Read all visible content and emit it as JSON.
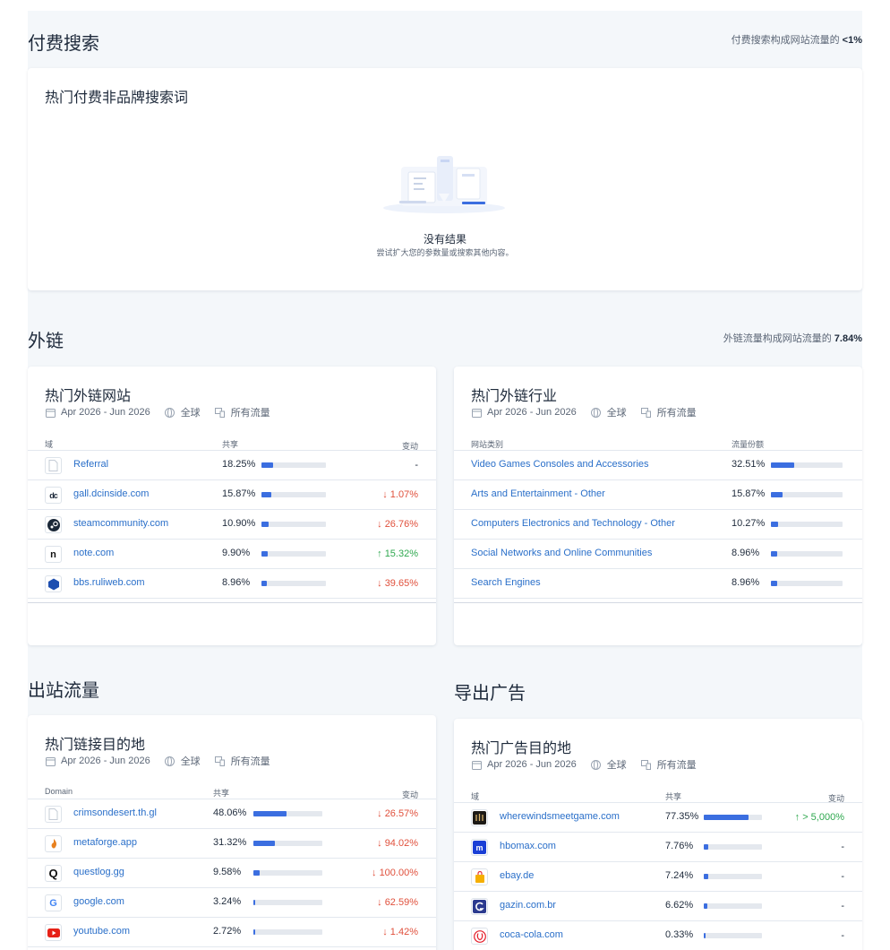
{
  "paid": {
    "title": "付费搜索",
    "note_prefix": "付费搜索构成网站流量的 ",
    "note_value": "<1%",
    "card_title": "热门付费非品牌搜索词",
    "empty_title": "没有结果",
    "empty_sub": "尝试扩大您的参数量或搜索其他内容。"
  },
  "backlinks": {
    "title": "外链",
    "note_prefix": "外链流量构成网站流量的 ",
    "note_value": "7.84%"
  },
  "meta": {
    "date": "Apr 2026 - Jun 2026",
    "region": "全球",
    "traffic": "所有流量"
  },
  "top_sites": {
    "title": "热门外链网站",
    "col_domain": "域",
    "col_share": "共享",
    "col_change": "变动",
    "rows": [
      {
        "name": "Referral",
        "share": "18.25%",
        "share_value": 18.25,
        "change": "-",
        "dir": "flat",
        "icon": "page-icon"
      },
      {
        "name": "gall.dcinside.com",
        "share": "15.87%",
        "share_value": 15.87,
        "change": "1.07%",
        "dir": "down",
        "icon": "dcinside-icon"
      },
      {
        "name": "steamcommunity.com",
        "share": "10.90%",
        "share_value": 10.9,
        "change": "26.76%",
        "dir": "down",
        "icon": "steam-icon"
      },
      {
        "name": "note.com",
        "share": "9.90%",
        "share_value": 9.9,
        "change": "15.32%",
        "dir": "up",
        "icon": "note-icon"
      },
      {
        "name": "bbs.ruliweb.com",
        "share": "8.96%",
        "share_value": 8.96,
        "change": "39.65%",
        "dir": "down",
        "icon": "ruliweb-icon"
      }
    ]
  },
  "top_industries": {
    "title": "热门外链行业",
    "col_category": "网站类别",
    "col_share": "流量份额",
    "rows": [
      {
        "name": "Video Games Consoles and Accessories",
        "share": "32.51%",
        "share_value": 32.51
      },
      {
        "name": "Arts and Entertainment - Other",
        "share": "15.87%",
        "share_value": 15.87
      },
      {
        "name": "Computers Electronics and Technology - Other",
        "share": "10.27%",
        "share_value": 10.27
      },
      {
        "name": "Social Networks and Online Communities",
        "share": "8.96%",
        "share_value": 8.96
      },
      {
        "name": "Search Engines",
        "share": "8.96%",
        "share_value": 8.96
      }
    ]
  },
  "outgoing": {
    "title": "出站流量",
    "card_title": "热门链接目的地",
    "col_domain": "Domain",
    "col_share": "共享",
    "col_change": "变动",
    "rows": [
      {
        "name": "crimsondesert.th.gl",
        "share": "48.06%",
        "share_value": 48.06,
        "change": "26.57%",
        "dir": "down",
        "icon": "page-icon"
      },
      {
        "name": "metaforge.app",
        "share": "31.32%",
        "share_value": 31.32,
        "change": "94.02%",
        "dir": "down",
        "icon": "metaforge-icon"
      },
      {
        "name": "questlog.gg",
        "share": "9.58%",
        "share_value": 9.58,
        "change": "100.00%",
        "dir": "down",
        "icon": "questlog-icon"
      },
      {
        "name": "google.com",
        "share": "3.24%",
        "share_value": 3.24,
        "change": "62.59%",
        "dir": "down",
        "icon": "google-icon"
      },
      {
        "name": "youtube.com",
        "share": "2.72%",
        "share_value": 2.72,
        "change": "1.42%",
        "dir": "down",
        "icon": "youtube-icon"
      }
    ]
  },
  "ads": {
    "title": "导出广告",
    "card_title": "热门广告目的地",
    "col_domain": "域",
    "col_share": "共享",
    "col_change": "变动",
    "rows": [
      {
        "name": "wherewindsmeetgame.com",
        "share": "77.35%",
        "share_value": 77.35,
        "change": "> 5,000%",
        "dir": "up",
        "icon": "wherewinds-icon"
      },
      {
        "name": "hbomax.com",
        "share": "7.76%",
        "share_value": 7.76,
        "change": "-",
        "dir": "flat",
        "icon": "hbomax-icon"
      },
      {
        "name": "ebay.de",
        "share": "7.24%",
        "share_value": 7.24,
        "change": "-",
        "dir": "flat",
        "icon": "ebay-icon"
      },
      {
        "name": "gazin.com.br",
        "share": "6.62%",
        "share_value": 6.62,
        "change": "-",
        "dir": "flat",
        "icon": "gazin-icon"
      },
      {
        "name": "coca-cola.com",
        "share": "0.33%",
        "share_value": 0.33,
        "change": "-",
        "dir": "flat",
        "icon": "cocacola-icon"
      }
    ]
  },
  "colors": {
    "bar_fill": "#3b6ee0",
    "link": "#2a6fc9",
    "down": "#e0503c",
    "up": "#2fa84f"
  }
}
